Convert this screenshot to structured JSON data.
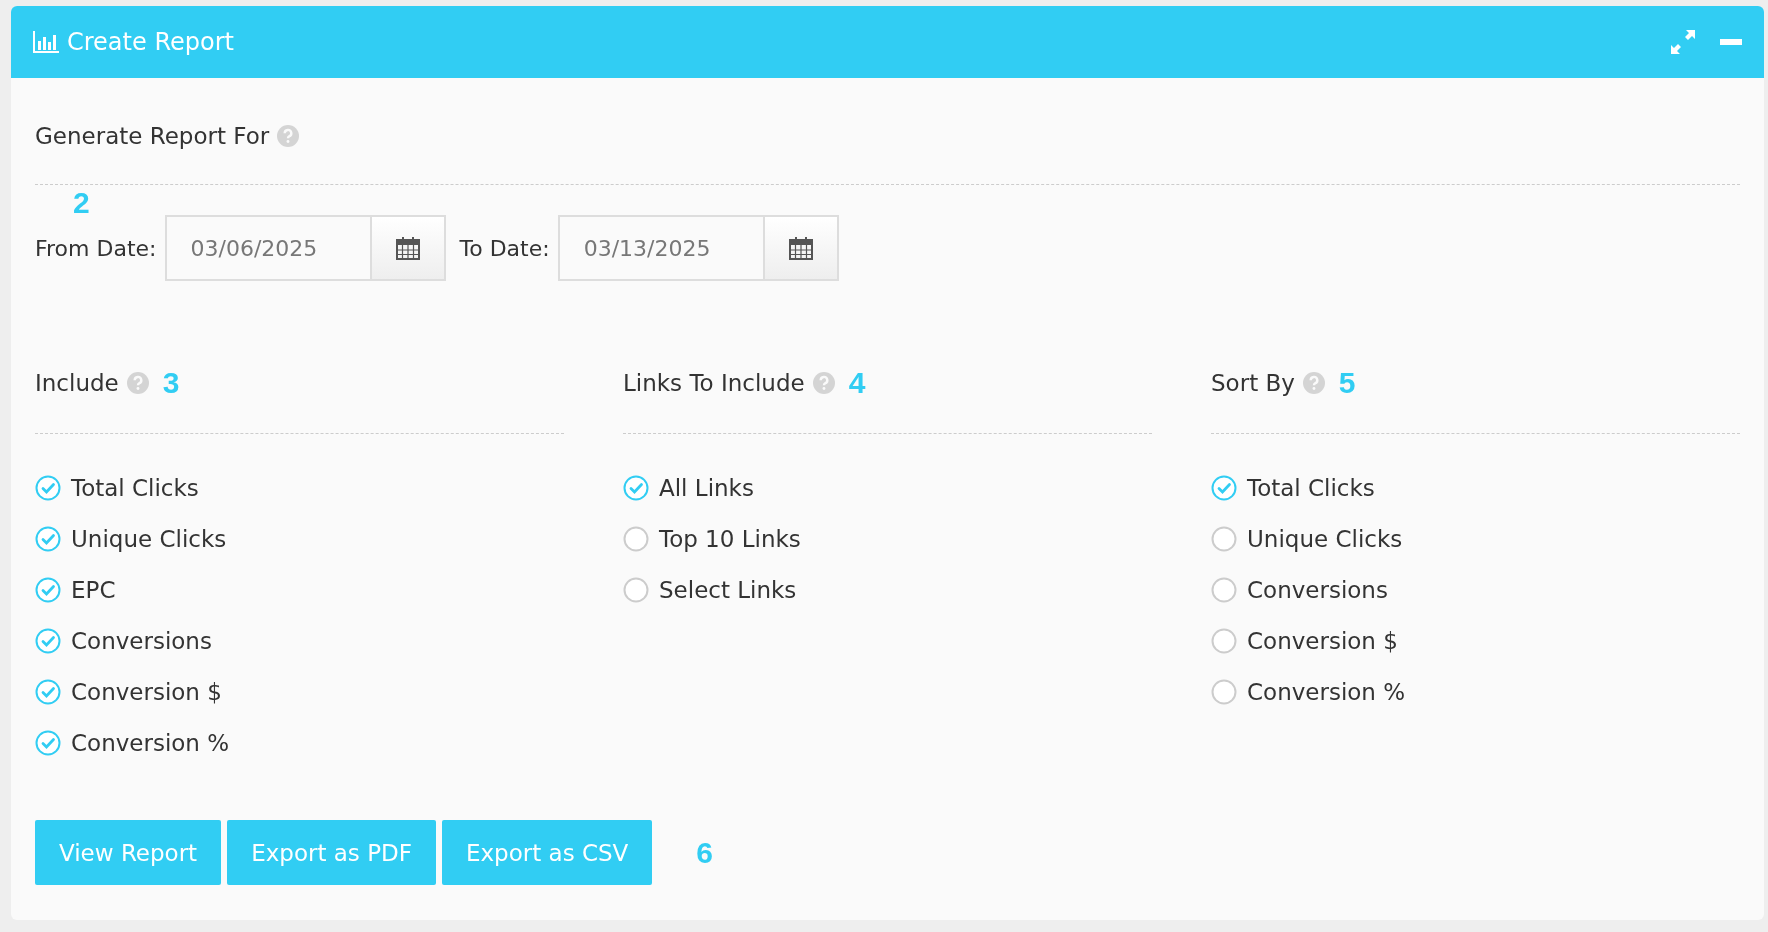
{
  "panel": {
    "title": "Create Report"
  },
  "generate": {
    "label": "Generate Report For"
  },
  "dates": {
    "marker": "2",
    "fields": [
      {
        "label": "From Date:",
        "value": "03/06/2025"
      },
      {
        "label": "To Date:",
        "value": "03/13/2025"
      }
    ]
  },
  "groups": [
    {
      "title": "Include",
      "marker": "3",
      "kind": "checkbox",
      "options": [
        {
          "label": "Total Clicks",
          "checked": true
        },
        {
          "label": "Unique Clicks",
          "checked": true
        },
        {
          "label": "EPC",
          "checked": true
        },
        {
          "label": "Conversions",
          "checked": true
        },
        {
          "label": "Conversion $",
          "checked": true
        },
        {
          "label": "Conversion %",
          "checked": true
        }
      ]
    },
    {
      "title": "Links To Include",
      "marker": "4",
      "kind": "radio",
      "options": [
        {
          "label": "All Links",
          "selected": true
        },
        {
          "label": "Top 10 Links",
          "selected": false
        },
        {
          "label": "Select Links",
          "selected": false
        }
      ]
    },
    {
      "title": "Sort By",
      "marker": "5",
      "kind": "radio",
      "options": [
        {
          "label": "Total Clicks",
          "selected": true
        },
        {
          "label": "Unique Clicks",
          "selected": false
        },
        {
          "label": "Conversions",
          "selected": false
        },
        {
          "label": "Conversion $",
          "selected": false
        },
        {
          "label": "Conversion %",
          "selected": false
        }
      ]
    }
  ],
  "buttons": [
    "View Report",
    "Export as PDF",
    "Export as CSV"
  ],
  "buttons_marker": "6"
}
